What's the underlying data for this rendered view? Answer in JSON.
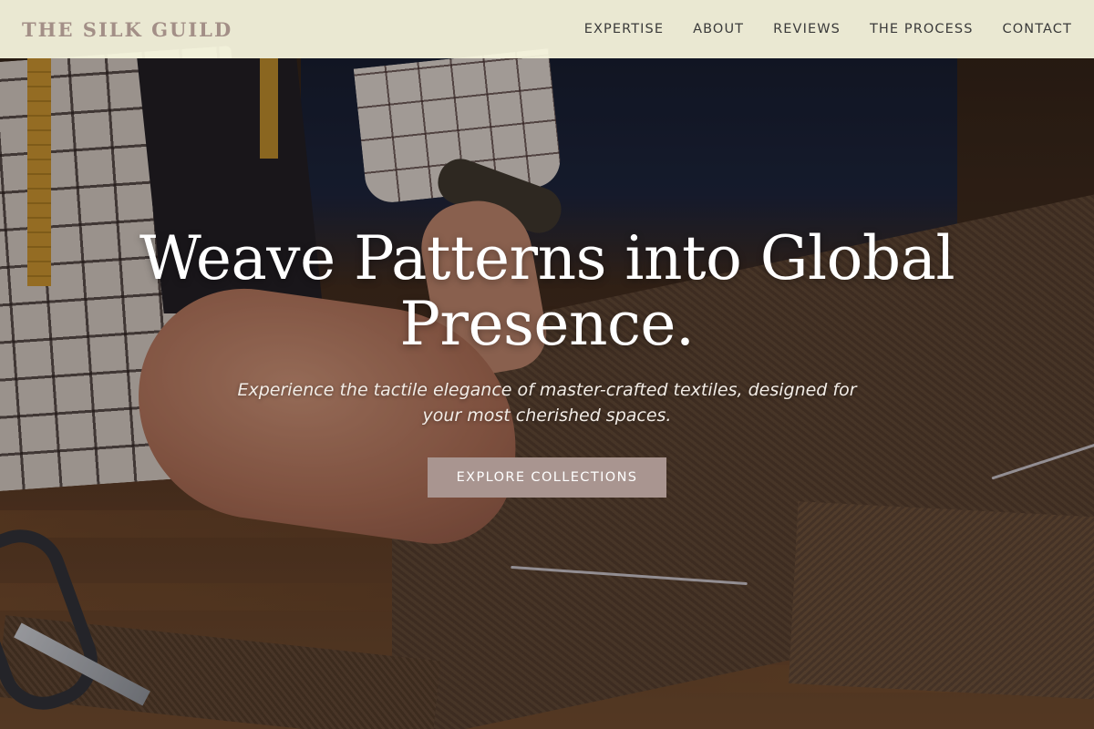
{
  "brand": {
    "logo_text": "THE SILK GUILD",
    "logo_color": "#a38f87"
  },
  "nav": {
    "items": [
      {
        "label": "EXPERTISE"
      },
      {
        "label": "ABOUT"
      },
      {
        "label": "REVIEWS"
      },
      {
        "label": "THE PROCESS"
      },
      {
        "label": "CONTACT"
      }
    ]
  },
  "hero": {
    "title": "Weave Patterns into Global Presence.",
    "subtitle": "Experience the tactile elegance of master-crafted textiles, designed for your most cherished spaces.",
    "cta_label": "EXPLORE COLLECTIONS",
    "cta_color": "#a99590",
    "background_description_icon": "tailor-cutting-fabric-photo"
  },
  "colors": {
    "header_bg": "#f7f5de",
    "nav_text": "#3a3a3a",
    "hero_text": "#ffffff"
  }
}
